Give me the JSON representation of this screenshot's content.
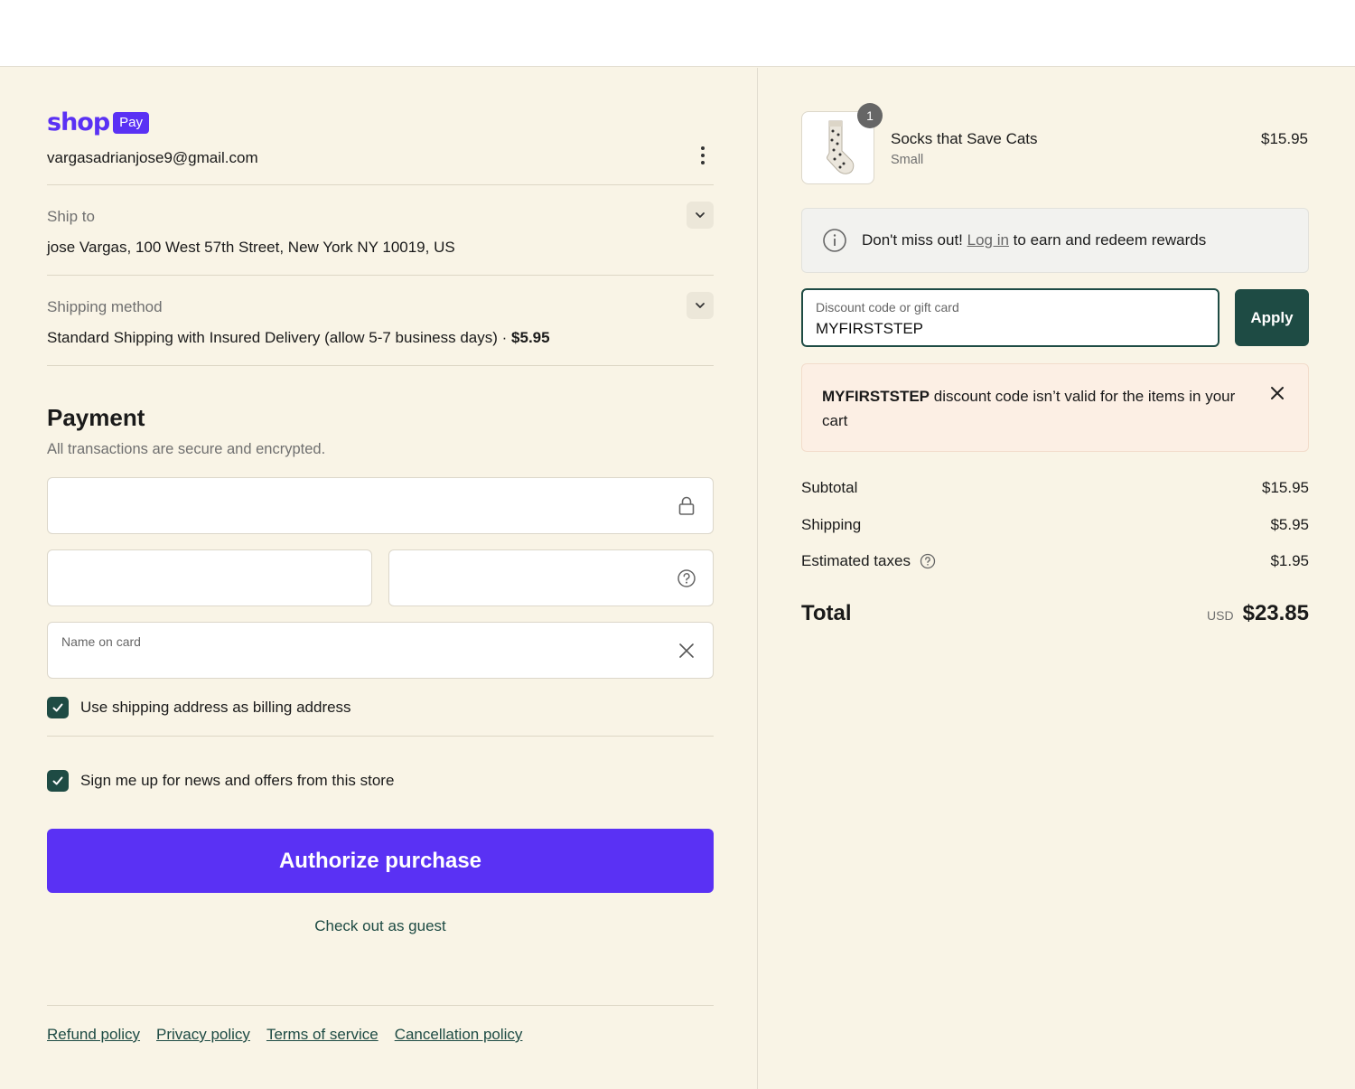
{
  "shoppay": {
    "shop_word": "shop",
    "pay_badge": "Pay",
    "email": "vargasadrianjose9@gmail.com"
  },
  "ship_to": {
    "label": "Ship to",
    "value": "jose Vargas, 100 West 57th Street, New York NY 10019, US"
  },
  "shipping_method": {
    "label": "Shipping method",
    "value": "Standard Shipping with Insured Delivery (allow 5-7 business days) · ",
    "price": "$5.95"
  },
  "payment": {
    "title": "Payment",
    "subtitle": "All transactions are secure and encrypted.",
    "name_on_card_label": "Name on card",
    "billing_checkbox_label": "Use shipping address as billing address",
    "billing_checked": true,
    "newsletter_checkbox_label": "Sign me up for news and offers from this store",
    "newsletter_checked": true
  },
  "actions": {
    "authorize": "Authorize purchase",
    "guest": "Check out as guest"
  },
  "footer_links": [
    "Refund policy",
    "Privacy policy",
    "Terms of service",
    "Cancellation policy"
  ],
  "product": {
    "quantity": "1",
    "name": "Socks that Save Cats",
    "variant": "Small",
    "price": "$15.95"
  },
  "rewards": {
    "prefix": "Don't miss out! ",
    "link": "Log in",
    "suffix": " to earn and redeem rewards"
  },
  "discount": {
    "label": "Discount code or gift card",
    "value": "MYFIRSTSTEP",
    "apply": "Apply"
  },
  "error": {
    "code": "MYFIRSTSTEP",
    "message": " discount code isn’t valid for the items in your cart"
  },
  "summary": {
    "subtotal_label": "Subtotal",
    "subtotal": "$15.95",
    "shipping_label": "Shipping",
    "shipping": "$5.95",
    "taxes_label": "Estimated taxes",
    "taxes": "$1.95",
    "total_label": "Total",
    "currency": "USD",
    "total": "$23.85"
  },
  "colors": {
    "accent": "#5a31f4",
    "green": "#1e4b44",
    "background": "#f9f4e6"
  }
}
